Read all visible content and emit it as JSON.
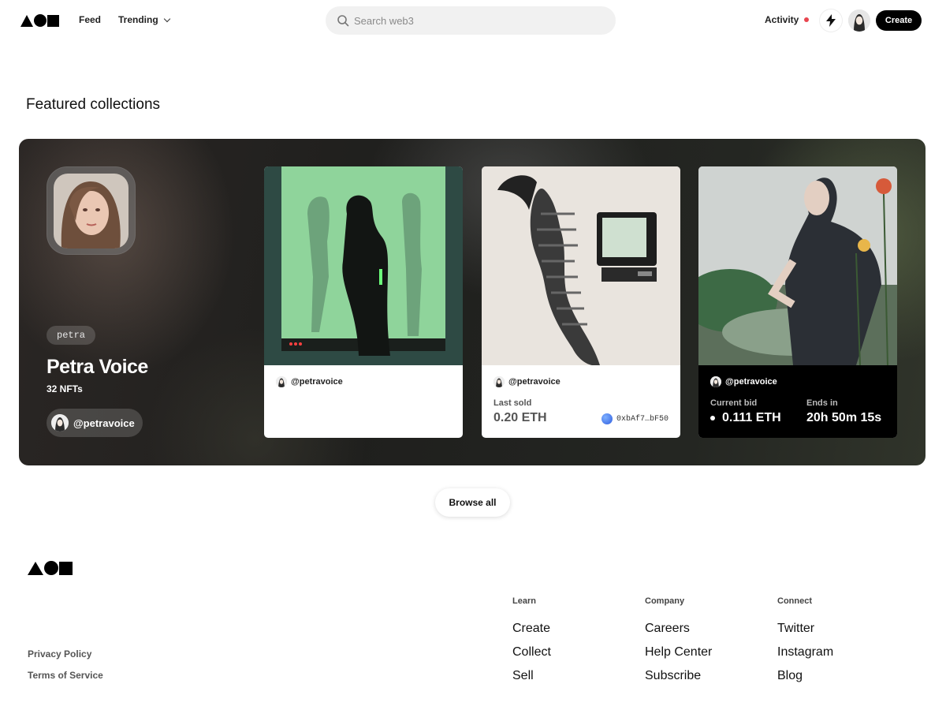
{
  "header": {
    "nav": {
      "feed": "Feed",
      "trending": "Trending"
    },
    "search": {
      "placeholder": "Search web3"
    },
    "activity": "Activity",
    "create": "Create"
  },
  "section_title": "Featured collections",
  "collection": {
    "chip": "petra",
    "name": "Petra Voice",
    "count": "32 NFTs",
    "user": "@petravoice"
  },
  "cards": [
    {
      "owner": "@petravoice"
    },
    {
      "owner": "@petravoice",
      "label": "Last sold",
      "value": "0.20 ETH",
      "address": "0xbAf7…bF50"
    },
    {
      "owner": "@petravoice",
      "bid_label": "Current bid",
      "bid_value": "0.111 ETH",
      "ends_label": "Ends in",
      "ends_value": "20h 50m 15s"
    }
  ],
  "browse_all": "Browse all",
  "footer": {
    "columns": [
      {
        "heading": "Learn",
        "links": [
          "Create",
          "Collect",
          "Sell"
        ]
      },
      {
        "heading": "Company",
        "links": [
          "Careers",
          "Help Center",
          "Subscribe"
        ]
      },
      {
        "heading": "Connect",
        "links": [
          "Twitter",
          "Instagram",
          "Blog"
        ]
      }
    ],
    "privacy": "Privacy Policy",
    "terms": "Terms of Service"
  },
  "colors": {
    "accent_dot": "#e8454f",
    "primary": "#000000"
  }
}
